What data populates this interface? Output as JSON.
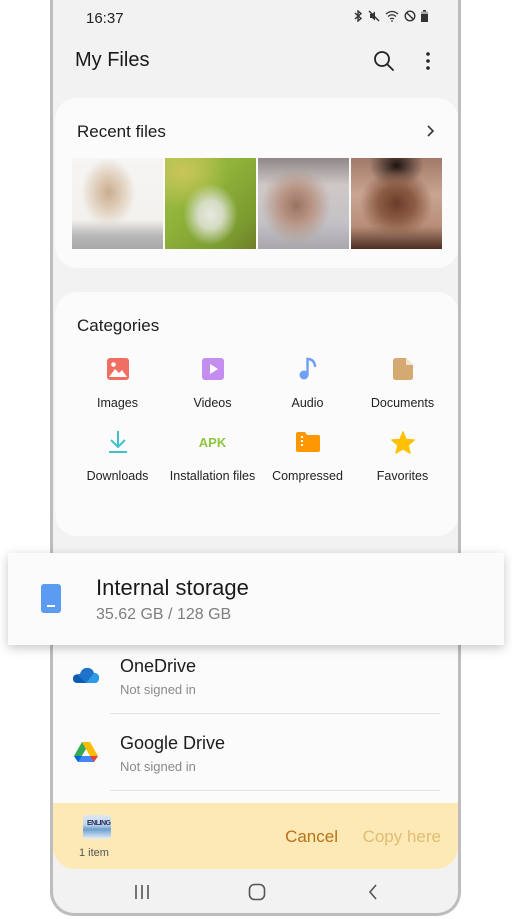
{
  "status_bar": {
    "time": "16:37",
    "icons": [
      "bluetooth-icon",
      "mute-icon",
      "wifi-icon",
      "do-not-disturb-icon",
      "battery-icon"
    ]
  },
  "app_bar": {
    "title": "My Files",
    "actions": [
      "search-icon",
      "more-options-icon"
    ]
  },
  "recent_files": {
    "title": "Recent files",
    "thumbnails": [
      "image-1",
      "image-2",
      "image-3",
      "image-4"
    ]
  },
  "categories": {
    "title": "Categories",
    "items": [
      {
        "label": "Images",
        "icon": "images-icon",
        "color": "#ef6f63"
      },
      {
        "label": "Videos",
        "icon": "videos-icon",
        "color": "#c48ef0"
      },
      {
        "label": "Audio",
        "icon": "audio-icon",
        "color": "#6e9ff3"
      },
      {
        "label": "Documents",
        "icon": "documents-icon",
        "color": "#d4aa72"
      },
      {
        "label": "Downloads",
        "icon": "downloads-icon",
        "color": "#3fc1c9"
      },
      {
        "label": "Installation files",
        "icon": "apk-icon",
        "color": "#8cc63f",
        "icon_text": "APK"
      },
      {
        "label": "Compressed",
        "icon": "compressed-icon",
        "color": "#ff9800"
      },
      {
        "label": "Favorites",
        "icon": "favorites-icon",
        "color": "#ffc107"
      }
    ]
  },
  "storage": {
    "name": "Internal storage",
    "usage": "35.62 GB / 128 GB",
    "used_gb": 35.62,
    "total_gb": 128,
    "icon_color": "#5b9cf2"
  },
  "cloud": [
    {
      "name": "OneDrive",
      "status": "Not signed in"
    },
    {
      "name": "Google Drive",
      "status": "Not signed in"
    }
  ],
  "copy_bar": {
    "item_count": "1 item",
    "thumb_text": "ENLING",
    "cancel_label": "Cancel",
    "copy_label": "Copy here",
    "background": "#fde9b5"
  },
  "nav_bar": {
    "buttons": [
      "recents-icon",
      "home-icon",
      "back-icon"
    ]
  }
}
